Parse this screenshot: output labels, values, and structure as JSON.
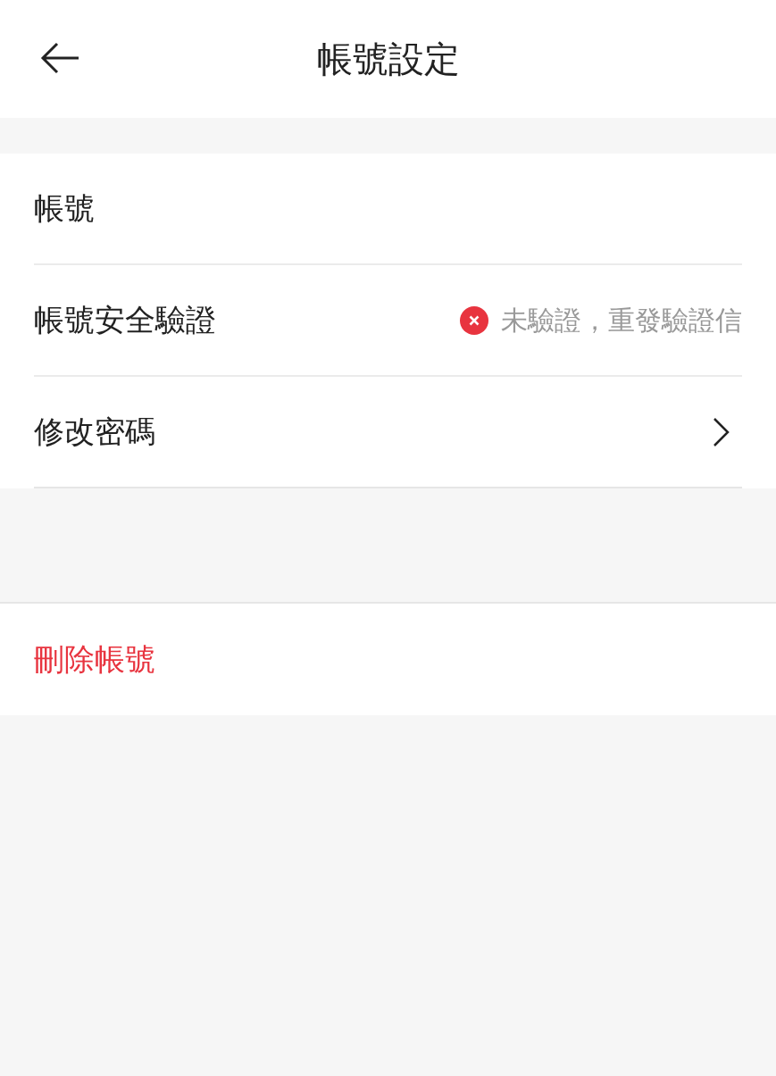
{
  "header": {
    "title": "帳號設定"
  },
  "settings": [
    {
      "kind": "plain",
      "label": "帳號"
    },
    {
      "kind": "status",
      "label": "帳號安全驗證",
      "status": "未驗證，重發驗證信",
      "verified": false
    },
    {
      "kind": "link",
      "label": "修改密碼"
    }
  ],
  "danger_action": {
    "label": "刪除帳號"
  }
}
